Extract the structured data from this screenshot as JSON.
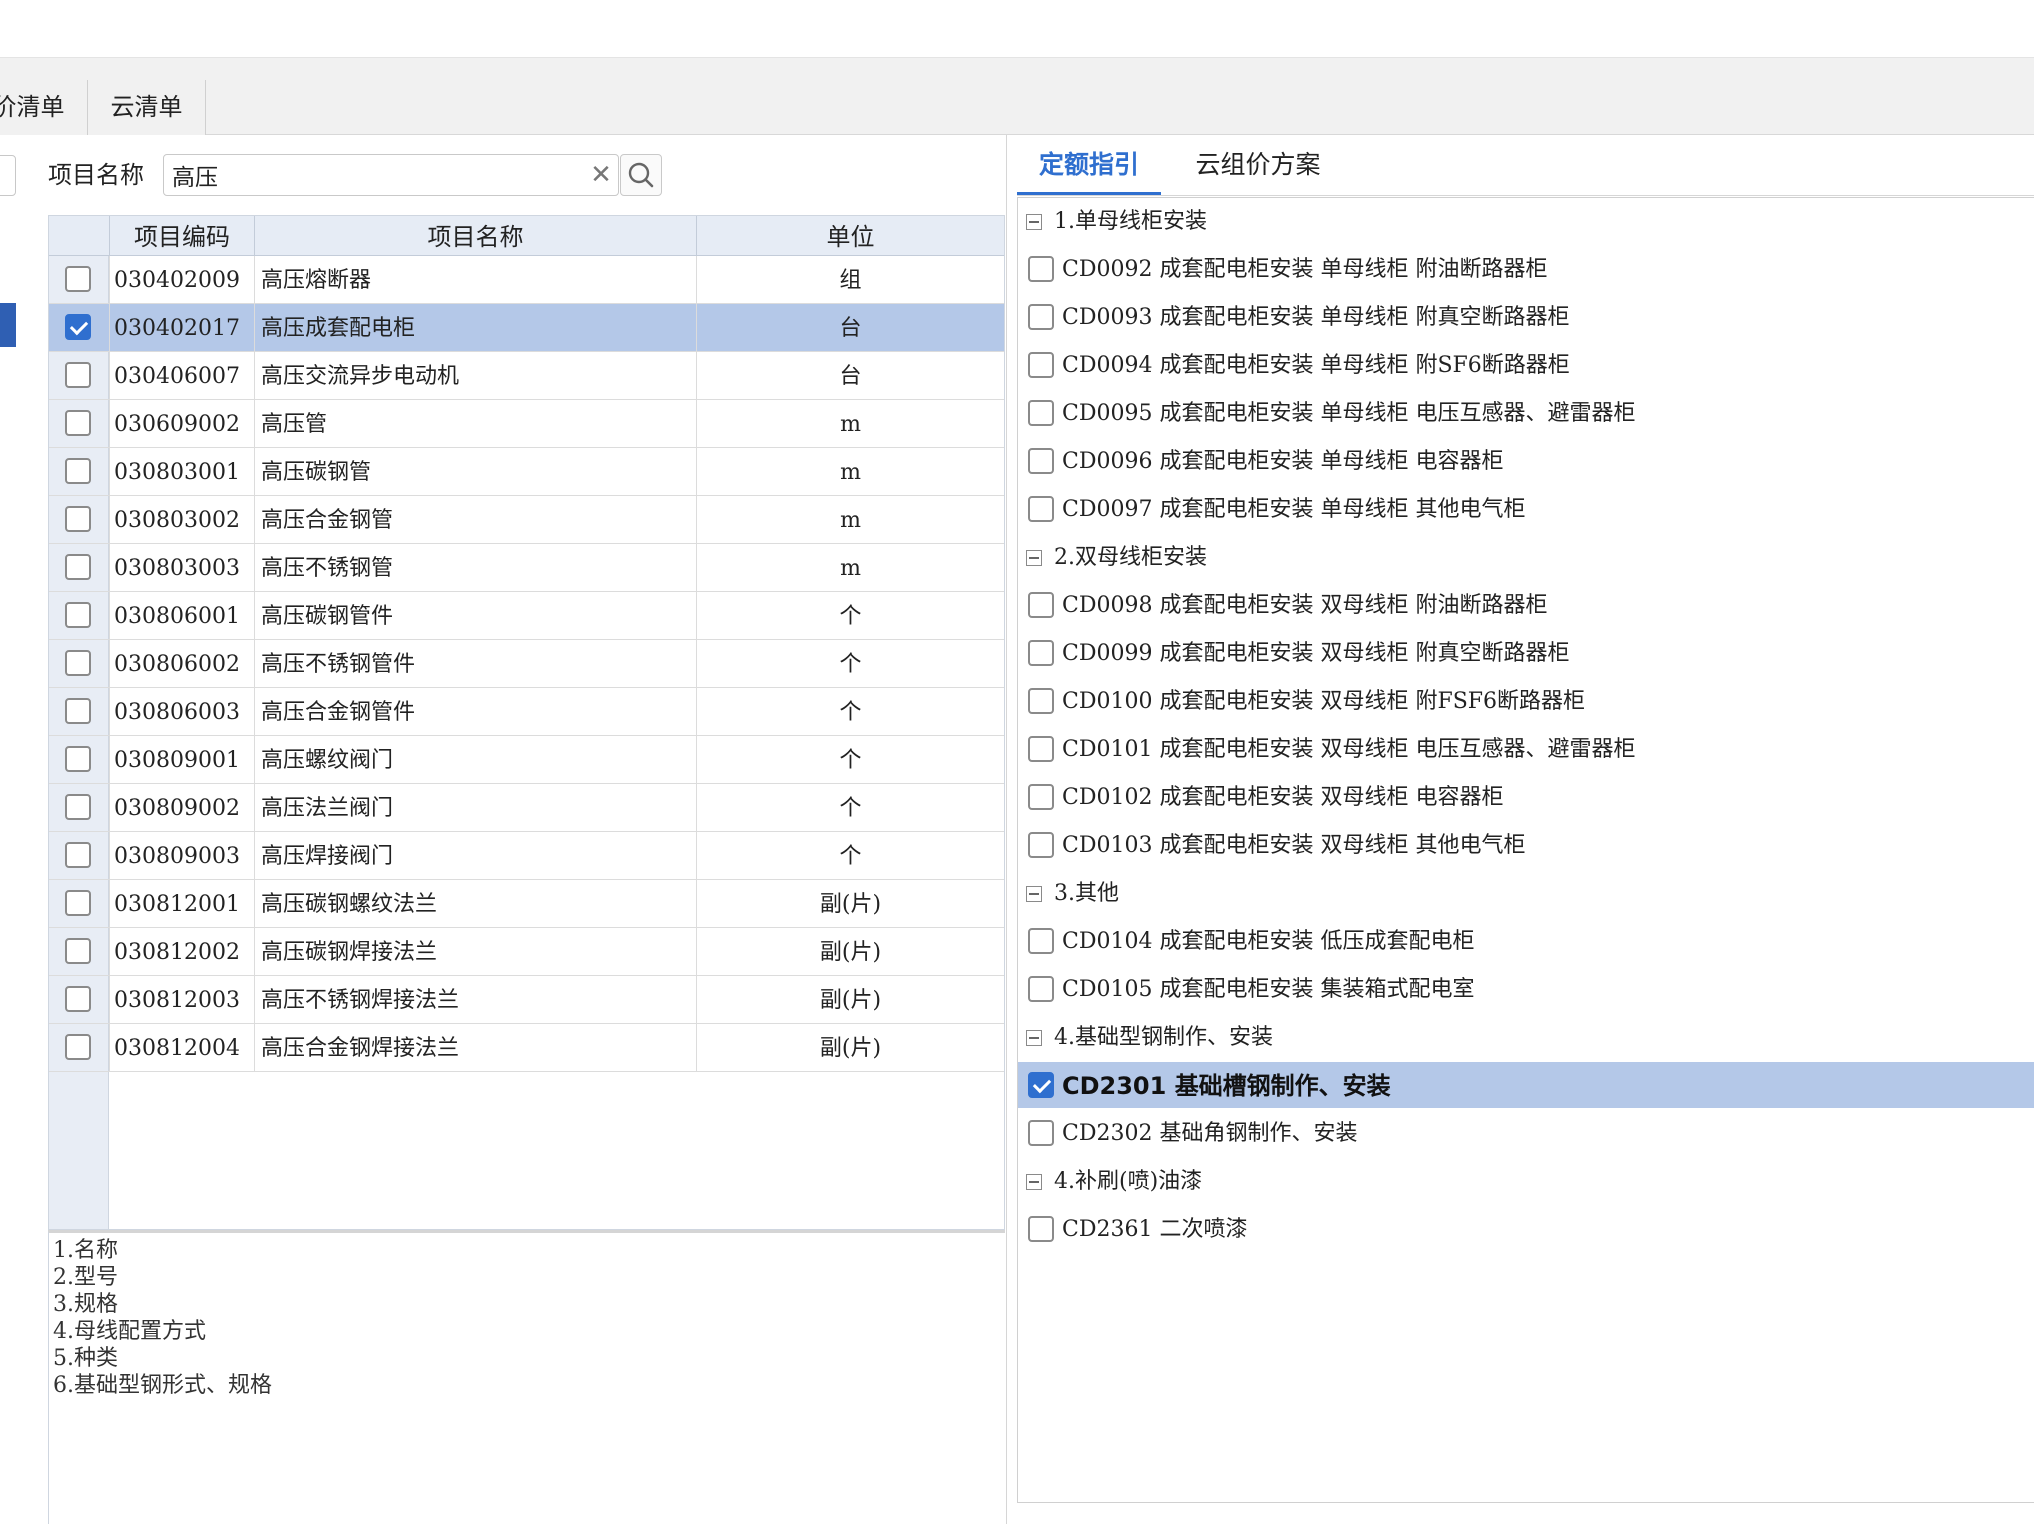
{
  "colors": {
    "accent": "#2f6fcf",
    "selection": "#b4c8e8",
    "header_bg": "#e6ecf5"
  },
  "top_tabs": [
    {
      "label": "价清单"
    },
    {
      "label": "云清单"
    }
  ],
  "search": {
    "label": "项目名称",
    "value": "高压",
    "clear_icon": "✕"
  },
  "grid": {
    "columns": {
      "code": "项目编码",
      "name": "项目名称",
      "unit": "单位"
    },
    "rows": [
      {
        "code": "030402009",
        "name": "高压熔断器",
        "unit": "组",
        "checked": false
      },
      {
        "code": "030402017",
        "name": "高压成套配电柜",
        "unit": "台",
        "checked": true
      },
      {
        "code": "030406007",
        "name": "高压交流异步电动机",
        "unit": "台",
        "checked": false
      },
      {
        "code": "030609002",
        "name": "高压管",
        "unit": "m",
        "checked": false
      },
      {
        "code": "030803001",
        "name": "高压碳钢管",
        "unit": "m",
        "checked": false
      },
      {
        "code": "030803002",
        "name": "高压合金钢管",
        "unit": "m",
        "checked": false
      },
      {
        "code": "030803003",
        "name": "高压不锈钢管",
        "unit": "m",
        "checked": false
      },
      {
        "code": "030806001",
        "name": "高压碳钢管件",
        "unit": "个",
        "checked": false
      },
      {
        "code": "030806002",
        "name": "高压不锈钢管件",
        "unit": "个",
        "checked": false
      },
      {
        "code": "030806003",
        "name": "高压合金钢管件",
        "unit": "个",
        "checked": false
      },
      {
        "code": "030809001",
        "name": "高压螺纹阀门",
        "unit": "个",
        "checked": false
      },
      {
        "code": "030809002",
        "name": "高压法兰阀门",
        "unit": "个",
        "checked": false
      },
      {
        "code": "030809003",
        "name": "高压焊接阀门",
        "unit": "个",
        "checked": false
      },
      {
        "code": "030812001",
        "name": "高压碳钢螺纹法兰",
        "unit": "副(片)",
        "checked": false
      },
      {
        "code": "030812002",
        "name": "高压碳钢焊接法兰",
        "unit": "副(片)",
        "checked": false
      },
      {
        "code": "030812003",
        "name": "高压不锈钢焊接法兰",
        "unit": "副(片)",
        "checked": false
      },
      {
        "code": "030812004",
        "name": "高压合金钢焊接法兰",
        "unit": "副(片)",
        "checked": false
      }
    ]
  },
  "description": [
    "1.名称",
    "2.型号",
    "3.规格",
    "4.母线配置方式",
    "5.种类",
    "6.基础型钢形式、规格"
  ],
  "right_tabs": {
    "guide": "定额指引",
    "cloud": "云组价方案"
  },
  "tree": [
    {
      "type": "group",
      "text": "1.单母线柜安装"
    },
    {
      "type": "item",
      "text": "CD0092 成套配电柜安装 单母线柜 附油断路器柜",
      "checked": false
    },
    {
      "type": "item",
      "text": "CD0093 成套配电柜安装 单母线柜 附真空断路器柜",
      "checked": false
    },
    {
      "type": "item",
      "text": "CD0094 成套配电柜安装 单母线柜 附SF6断路器柜",
      "checked": false
    },
    {
      "type": "item",
      "text": "CD0095 成套配电柜安装 单母线柜 电压互感器、避雷器柜",
      "checked": false
    },
    {
      "type": "item",
      "text": "CD0096 成套配电柜安装 单母线柜 电容器柜",
      "checked": false
    },
    {
      "type": "item",
      "text": "CD0097 成套配电柜安装 单母线柜 其他电气柜",
      "checked": false
    },
    {
      "type": "group",
      "text": "2.双母线柜安装"
    },
    {
      "type": "item",
      "text": "CD0098 成套配电柜安装 双母线柜 附油断路器柜",
      "checked": false
    },
    {
      "type": "item",
      "text": "CD0099 成套配电柜安装 双母线柜 附真空断路器柜",
      "checked": false
    },
    {
      "type": "item",
      "text": "CD0100 成套配电柜安装 双母线柜 附FSF6断路器柜",
      "checked": false
    },
    {
      "type": "item",
      "text": "CD0101 成套配电柜安装 双母线柜 电压互感器、避雷器柜",
      "checked": false
    },
    {
      "type": "item",
      "text": "CD0102 成套配电柜安装 双母线柜 电容器柜",
      "checked": false
    },
    {
      "type": "item",
      "text": "CD0103 成套配电柜安装 双母线柜 其他电气柜",
      "checked": false
    },
    {
      "type": "group",
      "text": "3.其他"
    },
    {
      "type": "item",
      "text": "CD0104 成套配电柜安装 低压成套配电柜",
      "checked": false
    },
    {
      "type": "item",
      "text": "CD0105 成套配电柜安装 集装箱式配电室",
      "checked": false
    },
    {
      "type": "group",
      "text": "4.基础型钢制作、安装"
    },
    {
      "type": "item",
      "text": "CD2301 基础槽钢制作、安装",
      "checked": true
    },
    {
      "type": "item",
      "text": "CD2302 基础角钢制作、安装",
      "checked": false
    },
    {
      "type": "group",
      "text": "4.补刷(喷)油漆"
    },
    {
      "type": "item",
      "text": "CD2361 二次喷漆",
      "checked": false
    }
  ]
}
